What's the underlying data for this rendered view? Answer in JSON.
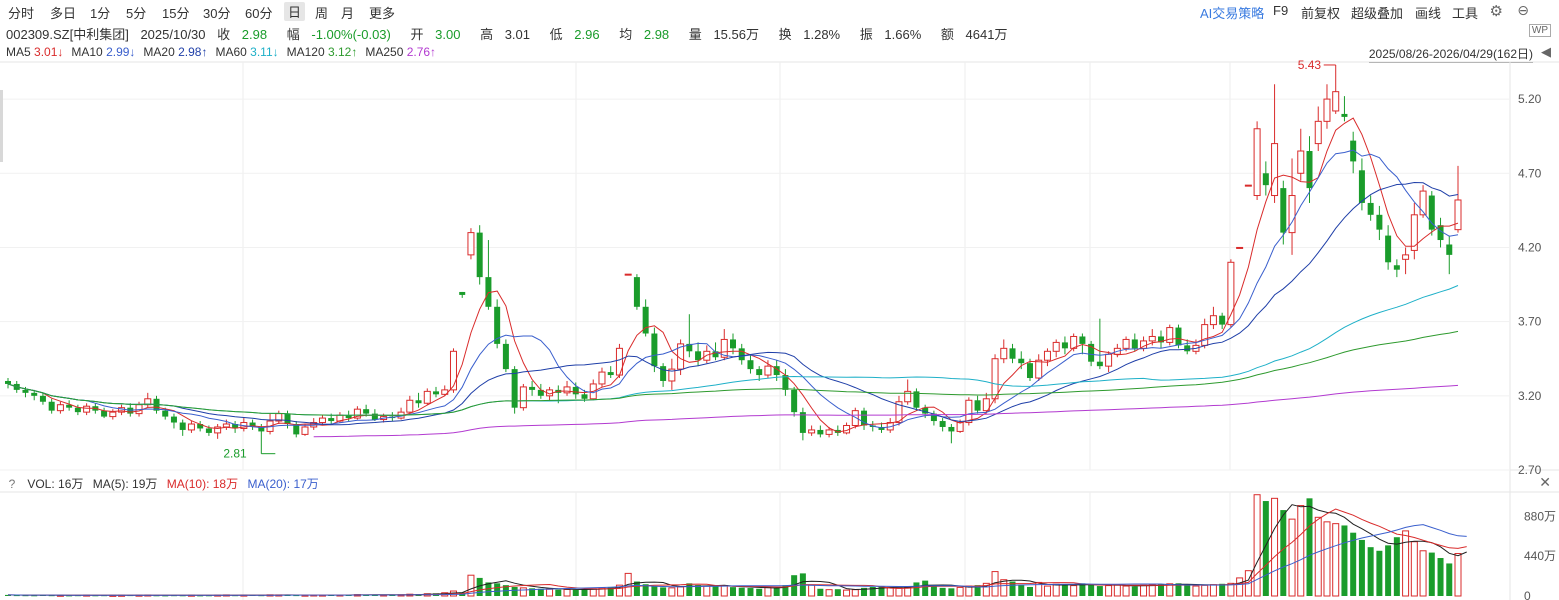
{
  "toolbar": {
    "periods": [
      "分时",
      "多日",
      "1分",
      "5分",
      "15分",
      "30分",
      "60分",
      "日",
      "周",
      "月",
      "更多"
    ],
    "active_period": "日",
    "tools": [
      "AI交易策略",
      "F9",
      "前复权",
      "超级叠加",
      "画线",
      "工具"
    ]
  },
  "quote": {
    "code": "002309.SZ[中利集团]",
    "date": "2025/10/30",
    "close_label": "收",
    "close": "2.98",
    "change_label": "幅",
    "change": "-1.00%(-0.03)",
    "open_label": "开",
    "open": "3.00",
    "high_label": "高",
    "high": "3.01",
    "low_label": "低",
    "low": "2.96",
    "avg_label": "均",
    "avg": "2.98",
    "vol_label": "量",
    "vol": "15.56万",
    "turnover_label": "换",
    "turnover": "1.28%",
    "amplitude_label": "振",
    "amplitude": "1.66%",
    "amount_label": "额",
    "amount": "4641万"
  },
  "ma_legend": [
    {
      "name": "MA5",
      "value": "3.01↓",
      "color": "#d92b2b"
    },
    {
      "name": "MA10",
      "value": "2.99↓",
      "color": "#3a5fcd"
    },
    {
      "name": "MA20",
      "value": "2.98↑",
      "color": "#1f3fa8"
    },
    {
      "name": "MA60",
      "value": "3.11↓",
      "color": "#1eb0c8"
    },
    {
      "name": "MA120",
      "value": "3.12↑",
      "color": "#2e9a2e"
    },
    {
      "name": "MA250",
      "value": "2.76↑",
      "color": "#b23ad0"
    }
  ],
  "date_range": "2025/08/26-2026/04/29(162日)",
  "price_axis": [
    "5.20",
    "4.70",
    "4.20",
    "3.70",
    "3.20",
    "2.70"
  ],
  "annotations": {
    "max_label": "5.43",
    "min_label": "2.81"
  },
  "volume_legend": {
    "help": "?",
    "vol": "VOL: 16万",
    "ma5": "MA(5): 19万",
    "ma10": "MA(10): 18万",
    "ma20": "MA(20): 17万"
  },
  "volume_axis": [
    "880万",
    "440万",
    "0"
  ],
  "colors": {
    "up": "#d92b2b",
    "down": "#1a9c2b",
    "ai": "#3a7be0"
  },
  "chart_data": {
    "type": "candlestick",
    "ylim": [
      2.7,
      5.45
    ],
    "candles": [
      [
        3.3,
        3.28,
        3.32,
        3.25
      ],
      [
        3.28,
        3.24,
        3.3,
        3.22
      ],
      [
        3.24,
        3.22,
        3.26,
        3.19
      ],
      [
        3.22,
        3.2,
        3.24,
        3.17
      ],
      [
        3.2,
        3.16,
        3.22,
        3.14
      ],
      [
        3.16,
        3.1,
        3.18,
        3.08
      ],
      [
        3.1,
        3.14,
        3.16,
        3.08
      ],
      [
        3.14,
        3.12,
        3.17,
        3.1
      ],
      [
        3.12,
        3.09,
        3.14,
        3.07
      ],
      [
        3.09,
        3.13,
        3.15,
        3.07
      ],
      [
        3.13,
        3.1,
        3.15,
        3.08
      ],
      [
        3.1,
        3.06,
        3.12,
        3.05
      ],
      [
        3.06,
        3.09,
        3.11,
        3.04
      ],
      [
        3.09,
        3.12,
        3.14,
        3.07
      ],
      [
        3.12,
        3.08,
        3.15,
        3.06
      ],
      [
        3.08,
        3.14,
        3.16,
        3.06
      ],
      [
        3.14,
        3.18,
        3.22,
        3.12
      ],
      [
        3.18,
        3.1,
        3.2,
        3.08
      ],
      [
        3.1,
        3.06,
        3.12,
        3.04
      ],
      [
        3.06,
        3.02,
        3.08,
        2.98
      ],
      [
        3.02,
        2.97,
        3.04,
        2.93
      ],
      [
        2.97,
        3.01,
        3.03,
        2.95
      ],
      [
        3.01,
        2.98,
        3.03,
        2.96
      ],
      [
        2.98,
        2.95,
        3.0,
        2.93
      ],
      [
        2.95,
        2.99,
        3.01,
        2.91
      ],
      [
        2.99,
        3.01,
        3.04,
        2.97
      ],
      [
        3.01,
        2.98,
        3.03,
        2.95
      ],
      [
        2.98,
        3.02,
        3.05,
        2.96
      ],
      [
        3.02,
        2.99,
        3.04,
        2.97
      ],
      [
        2.99,
        2.96,
        3.01,
        2.81
      ],
      [
        2.96,
        3.03,
        3.08,
        2.94
      ],
      [
        3.03,
        3.08,
        3.1,
        3.01
      ],
      [
        3.08,
        3.01,
        3.1,
        2.98
      ],
      [
        3.01,
        2.94,
        3.03,
        2.92
      ],
      [
        2.94,
        2.99,
        3.01,
        2.93
      ],
      [
        2.99,
        3.02,
        3.05,
        2.97
      ],
      [
        3.02,
        3.05,
        3.07,
        3.0
      ],
      [
        3.05,
        3.03,
        3.08,
        3.01
      ],
      [
        3.03,
        3.07,
        3.09,
        3.02
      ],
      [
        3.07,
        3.05,
        3.1,
        3.03
      ],
      [
        3.05,
        3.11,
        3.13,
        3.04
      ],
      [
        3.11,
        3.08,
        3.14,
        3.06
      ],
      [
        3.08,
        3.04,
        3.11,
        3.03
      ],
      [
        3.04,
        3.06,
        3.08,
        3.02
      ],
      [
        3.06,
        3.05,
        3.09,
        3.03
      ],
      [
        3.05,
        3.09,
        3.12,
        3.04
      ],
      [
        3.09,
        3.17,
        3.2,
        3.08
      ],
      [
        3.17,
        3.15,
        3.22,
        3.12
      ],
      [
        3.15,
        3.23,
        3.25,
        3.14
      ],
      [
        3.23,
        3.21,
        3.26,
        3.19
      ],
      [
        3.21,
        3.24,
        3.27,
        3.2
      ],
      [
        3.24,
        3.5,
        3.52,
        3.22
      ],
      [
        3.9,
        3.88,
        3.9,
        3.86
      ],
      [
        4.15,
        4.3,
        4.33,
        4.12
      ],
      [
        4.3,
        4.0,
        4.35,
        3.95
      ],
      [
        4.0,
        3.8,
        4.25,
        3.78
      ],
      [
        3.8,
        3.55,
        3.85,
        3.52
      ],
      [
        3.55,
        3.38,
        3.58,
        3.36
      ],
      [
        3.38,
        3.12,
        3.4,
        3.08
      ],
      [
        3.12,
        3.26,
        3.28,
        3.1
      ],
      [
        3.26,
        3.24,
        3.3,
        3.2
      ],
      [
        3.24,
        3.2,
        3.28,
        3.18
      ],
      [
        3.2,
        3.24,
        3.26,
        3.17
      ],
      [
        3.24,
        3.22,
        3.27,
        3.15
      ],
      [
        3.22,
        3.26,
        3.3,
        3.2
      ],
      [
        3.26,
        3.21,
        3.29,
        3.18
      ],
      [
        3.21,
        3.18,
        3.24,
        3.16
      ],
      [
        3.18,
        3.28,
        3.31,
        3.17
      ],
      [
        3.28,
        3.36,
        3.39,
        3.26
      ],
      [
        3.36,
        3.34,
        3.4,
        3.32
      ],
      [
        3.34,
        3.52,
        3.55,
        3.32
      ],
      [
        4.02,
        4.02,
        4.02,
        4.02
      ],
      [
        4.0,
        3.8,
        4.02,
        3.78
      ],
      [
        3.8,
        3.62,
        3.85,
        3.6
      ],
      [
        3.62,
        3.4,
        3.66,
        3.36
      ],
      [
        3.4,
        3.3,
        3.42,
        3.26
      ],
      [
        3.3,
        3.38,
        3.45,
        3.24
      ],
      [
        3.38,
        3.55,
        3.58,
        3.34
      ],
      [
        3.55,
        3.5,
        3.75,
        3.46
      ],
      [
        3.5,
        3.44,
        3.56,
        3.4
      ],
      [
        3.44,
        3.5,
        3.54,
        3.42
      ],
      [
        3.5,
        3.46,
        3.56,
        3.44
      ],
      [
        3.46,
        3.58,
        3.65,
        3.44
      ],
      [
        3.58,
        3.52,
        3.62,
        3.48
      ],
      [
        3.52,
        3.44,
        3.55,
        3.41
      ],
      [
        3.44,
        3.38,
        3.48,
        3.35
      ],
      [
        3.38,
        3.34,
        3.4,
        3.3
      ],
      [
        3.34,
        3.4,
        3.44,
        3.32
      ],
      [
        3.4,
        3.34,
        3.44,
        3.3
      ],
      [
        3.34,
        3.24,
        3.38,
        3.2
      ],
      [
        3.24,
        3.09,
        3.26,
        3.06
      ],
      [
        3.09,
        2.95,
        3.12,
        2.9
      ],
      [
        2.95,
        2.97,
        3.0,
        2.93
      ],
      [
        2.97,
        2.94,
        3.0,
        2.92
      ],
      [
        2.94,
        2.97,
        2.99,
        2.92
      ],
      [
        2.97,
        2.95,
        3.0,
        2.93
      ],
      [
        2.95,
        3.0,
        3.02,
        2.94
      ],
      [
        3.0,
        3.1,
        3.12,
        2.98
      ],
      [
        3.1,
        3.0,
        3.12,
        2.97
      ],
      [
        3.0,
        2.99,
        3.03,
        2.96
      ],
      [
        2.99,
        2.97,
        3.02,
        2.95
      ],
      [
        2.97,
        3.02,
        3.05,
        2.95
      ],
      [
        3.02,
        3.16,
        3.2,
        3.0
      ],
      [
        3.16,
        3.23,
        3.31,
        3.14
      ],
      [
        3.23,
        3.12,
        3.25,
        3.1
      ],
      [
        3.12,
        3.08,
        3.14,
        3.05
      ],
      [
        3.08,
        3.03,
        3.1,
        3.0
      ],
      [
        3.03,
        2.99,
        3.05,
        2.96
      ],
      [
        2.99,
        2.96,
        3.01,
        2.88
      ],
      [
        2.96,
        3.02,
        3.04,
        2.95
      ],
      [
        3.02,
        3.17,
        3.19,
        3.0
      ],
      [
        3.17,
        3.1,
        3.2,
        3.08
      ],
      [
        3.1,
        3.18,
        3.22,
        3.08
      ],
      [
        3.18,
        3.45,
        3.48,
        3.15
      ],
      [
        3.45,
        3.52,
        3.58,
        3.42
      ],
      [
        3.52,
        3.45,
        3.55,
        3.42
      ],
      [
        3.45,
        3.42,
        3.5,
        3.38
      ],
      [
        3.42,
        3.32,
        3.45,
        3.3
      ],
      [
        3.32,
        3.44,
        3.48,
        3.3
      ],
      [
        3.44,
        3.5,
        3.52,
        3.4
      ],
      [
        3.5,
        3.56,
        3.58,
        3.46
      ],
      [
        3.56,
        3.52,
        3.6,
        3.48
      ],
      [
        3.52,
        3.6,
        3.62,
        3.5
      ],
      [
        3.6,
        3.55,
        3.62,
        3.48
      ],
      [
        3.55,
        3.43,
        3.57,
        3.4
      ],
      [
        3.43,
        3.4,
        3.72,
        3.38
      ],
      [
        3.4,
        3.48,
        3.5,
        3.36
      ],
      [
        3.48,
        3.52,
        3.55,
        3.46
      ],
      [
        3.52,
        3.58,
        3.6,
        3.5
      ],
      [
        3.58,
        3.52,
        3.62,
        3.5
      ],
      [
        3.52,
        3.57,
        3.6,
        3.5
      ],
      [
        3.57,
        3.6,
        3.65,
        3.54
      ],
      [
        3.6,
        3.56,
        3.64,
        3.52
      ],
      [
        3.56,
        3.66,
        3.68,
        3.54
      ],
      [
        3.66,
        3.54,
        3.68,
        3.52
      ],
      [
        3.54,
        3.5,
        3.58,
        3.48
      ],
      [
        3.5,
        3.54,
        3.58,
        3.48
      ],
      [
        3.54,
        3.68,
        3.72,
        3.52
      ],
      [
        3.68,
        3.74,
        3.8,
        3.65
      ],
      [
        3.74,
        3.68,
        3.76,
        3.65
      ],
      [
        3.68,
        4.1,
        4.12,
        3.66
      ],
      [
        4.2,
        4.2,
        4.2,
        4.2
      ],
      [
        4.62,
        4.62,
        4.62,
        4.62
      ],
      [
        4.55,
        5.0,
        5.05,
        4.52
      ],
      [
        4.7,
        4.62,
        4.78,
        4.55
      ],
      [
        4.55,
        4.9,
        5.3,
        4.5
      ],
      [
        4.6,
        4.3,
        4.65,
        4.22
      ],
      [
        4.3,
        4.55,
        4.8,
        4.15
      ],
      [
        4.7,
        4.85,
        5.0,
        4.65
      ],
      [
        4.85,
        4.6,
        4.95,
        4.5
      ],
      [
        4.9,
        5.05,
        5.15,
        4.85
      ],
      [
        5.05,
        5.2,
        5.3,
        5.0
      ],
      [
        5.12,
        5.25,
        5.43,
        5.1
      ],
      [
        5.1,
        5.08,
        5.22,
        5.05
      ],
      [
        4.92,
        4.78,
        4.98,
        4.7
      ],
      [
        4.72,
        4.5,
        4.8,
        4.45
      ],
      [
        4.5,
        4.42,
        4.55,
        4.38
      ],
      [
        4.42,
        4.32,
        4.48,
        4.25
      ],
      [
        4.28,
        4.1,
        4.35,
        4.05
      ],
      [
        4.08,
        4.05,
        4.12,
        4.0
      ],
      [
        4.12,
        4.15,
        4.2,
        4.02
      ],
      [
        4.18,
        4.42,
        4.5,
        4.12
      ],
      [
        4.42,
        4.58,
        4.62,
        4.4
      ],
      [
        4.55,
        4.32,
        4.58,
        4.28
      ],
      [
        4.35,
        4.25,
        4.4,
        4.2
      ],
      [
        4.22,
        4.15,
        4.28,
        4.02
      ],
      [
        4.32,
        4.52,
        4.75,
        4.3
      ]
    ],
    "volume_ylim": [
      0,
      1150
    ],
    "volumes": [
      12,
      10,
      9,
      8,
      11,
      9,
      8,
      7,
      9,
      10,
      8,
      9,
      7,
      8,
      10,
      9,
      11,
      8,
      7,
      9,
      8,
      9,
      7,
      8,
      10,
      12,
      9,
      10,
      11,
      9,
      13,
      12,
      14,
      10,
      9,
      11,
      10,
      12,
      11,
      13,
      15,
      12,
      14,
      11,
      12,
      14,
      20,
      22,
      25,
      30,
      36,
      55,
      40,
      230,
      200,
      150,
      140,
      120,
      100,
      90,
      85,
      80,
      75,
      70,
      72,
      68,
      74,
      80,
      90,
      100,
      120,
      250,
      160,
      130,
      110,
      95,
      90,
      100,
      140,
      120,
      110,
      105,
      115,
      98,
      92,
      88,
      80,
      95,
      90,
      120,
      230,
      250,
      120,
      80,
      70,
      75,
      65,
      70,
      90,
      100,
      110,
      95,
      85,
      90,
      150,
      170,
      110,
      90,
      85,
      95,
      110,
      120,
      140,
      270,
      180,
      160,
      120,
      100,
      150,
      110,
      130,
      120,
      115,
      140,
      125,
      110,
      115,
      120,
      110,
      105,
      118,
      122,
      130,
      135,
      140,
      120,
      110,
      118,
      125,
      135,
      140,
      200,
      280,
      1120,
      1050,
      1080,
      950,
      850,
      1000,
      1080,
      870,
      820,
      800,
      780,
      700,
      620,
      540,
      500,
      560,
      650,
      720,
      600,
      500,
      480,
      420,
      360,
      470,
      700
    ]
  }
}
